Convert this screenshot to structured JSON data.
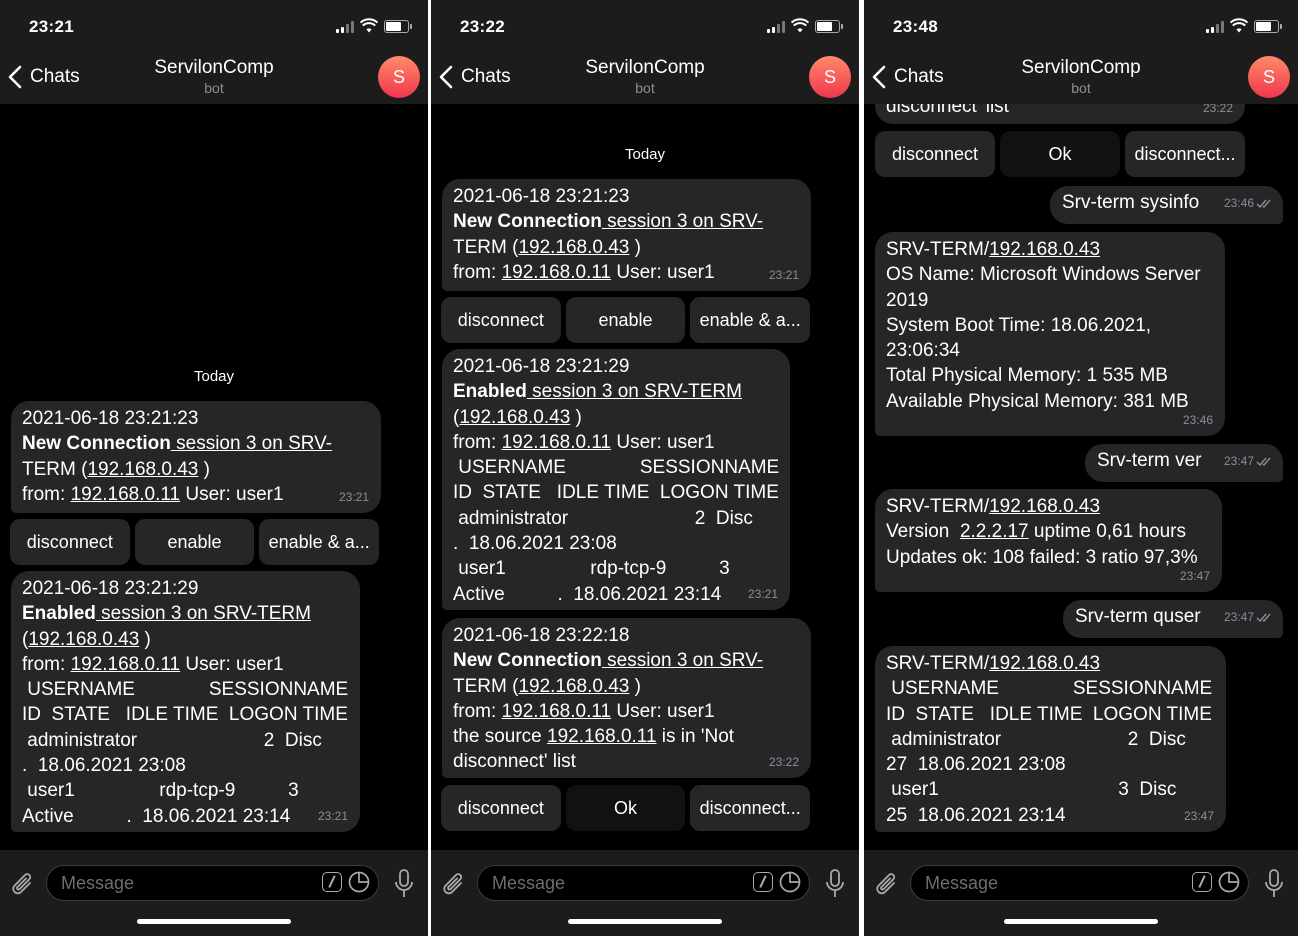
{
  "header": {
    "back_label": "Chats",
    "title": "ServilonComp",
    "subtitle": "bot",
    "avatar_letter": "S"
  },
  "input": {
    "placeholder": "Message"
  },
  "date_divider": "Today",
  "colors": {
    "bubble": "#262628",
    "bar": "#1c1c1d",
    "avatar_from": "#ff8a6a",
    "avatar_to": "#f0364c"
  },
  "screens": [
    {
      "status_time": "23:21",
      "msg1": {
        "lines": [
          [
            "2021-06-18 23:21:23"
          ],
          [
            "New Connection",
            " session 3 on SRV-"
          ],
          [
            "TERM (",
            "192.168.0.43",
            " )"
          ],
          [
            "from: ",
            "192.168.0.11",
            " User: user1"
          ]
        ],
        "time": "23:21"
      },
      "kb1": [
        "disconnect",
        "enable",
        "enable & a..."
      ],
      "msg2": {
        "lines": [
          [
            "2021-06-18 23:21:29"
          ],
          [
            "Enabled",
            " session 3 on SRV-TERM"
          ],
          [
            "(",
            "192.168.0.43",
            " )"
          ],
          [
            "from: ",
            "192.168.0.11",
            " User: user1"
          ],
          [
            " USERNAME              SESSIONNAME"
          ],
          [
            "ID  STATE   IDLE TIME  LOGON TIME"
          ],
          [
            " administrator                        2  Disc"
          ],
          [
            ".  18.06.2021 23:08"
          ],
          [
            " user1                rdp-tcp-9          3"
          ],
          [
            "Active          .  18.06.2021 23:14"
          ]
        ],
        "time": "23:21"
      }
    },
    {
      "status_time": "23:22",
      "msg1": {
        "lines": [
          [
            "2021-06-18 23:21:23"
          ],
          [
            "New Connection",
            " session 3 on SRV-"
          ],
          [
            "TERM (",
            "192.168.0.43",
            " )"
          ],
          [
            "from: ",
            "192.168.0.11",
            " User: user1"
          ]
        ],
        "time": "23:21"
      },
      "kb1": [
        "disconnect",
        "enable",
        "enable & a..."
      ],
      "msg2": {
        "lines": [
          [
            "2021-06-18 23:21:29"
          ],
          [
            "Enabled",
            " session 3 on SRV-TERM"
          ],
          [
            "(",
            "192.168.0.43",
            " )"
          ],
          [
            "from: ",
            "192.168.0.11",
            " User: user1"
          ],
          [
            " USERNAME              SESSIONNAME"
          ],
          [
            "ID  STATE   IDLE TIME  LOGON TIME"
          ],
          [
            " administrator                        2  Disc"
          ],
          [
            ".  18.06.2021 23:08"
          ],
          [
            " user1                rdp-tcp-9          3"
          ],
          [
            "Active          .  18.06.2021 23:14"
          ]
        ],
        "time": "23:21"
      },
      "msg3": {
        "lines": [
          [
            "2021-06-18 23:22:18"
          ],
          [
            "New Connection",
            " session 3 on SRV-"
          ],
          [
            "TERM (",
            "192.168.0.43",
            " )"
          ],
          [
            "from: ",
            "192.168.0.11",
            " User: user1"
          ],
          [
            "the source ",
            "192.168.0.11",
            " is in 'Not"
          ],
          [
            "disconnect' list"
          ]
        ],
        "time": "23:22"
      },
      "kb2": [
        "disconnect",
        "Ok",
        "disconnect..."
      ]
    },
    {
      "status_time": "23:48",
      "partial": {
        "text": "disconnect' list",
        "time": "23:22"
      },
      "kb": [
        "disconnect",
        "Ok",
        "disconnect..."
      ],
      "out1": {
        "text": "Srv-term sysinfo",
        "time": "23:46"
      },
      "in1": {
        "lines": [
          [
            "SRV-TERM/",
            "192.168.0.43"
          ],
          [
            "OS Name: Microsoft Windows Server"
          ],
          [
            "2019"
          ],
          [
            "System Boot Time: 18.06.2021,"
          ],
          [
            "23:06:34"
          ],
          [
            "Total Physical Memory: 1 535 MB"
          ],
          [
            "Available Physical Memory: 381 MB"
          ]
        ],
        "time": "23:46"
      },
      "out2": {
        "text": "Srv-term ver",
        "time": "23:47"
      },
      "in2": {
        "lines": [
          [
            "SRV-TERM/",
            "192.168.0.43"
          ],
          [
            "Version  ",
            "2.2.2.17",
            " uptime 0,61 hours"
          ],
          [
            "Updates ok: 108 failed: 3 ratio 97,3%"
          ]
        ],
        "time": "23:47"
      },
      "out3": {
        "text": "Srv-term quser",
        "time": "23:47"
      },
      "in3": {
        "lines": [
          [
            "SRV-TERM/",
            "192.168.0.43"
          ],
          [
            " USERNAME              SESSIONNAME"
          ],
          [
            "ID  STATE   IDLE TIME  LOGON TIME"
          ],
          [
            " administrator                        2  Disc"
          ],
          [
            "27  18.06.2021 23:08"
          ],
          [
            " user1                                  3  Disc"
          ],
          [
            "25  18.06.2021 23:14"
          ]
        ],
        "time": "23:47"
      }
    }
  ]
}
